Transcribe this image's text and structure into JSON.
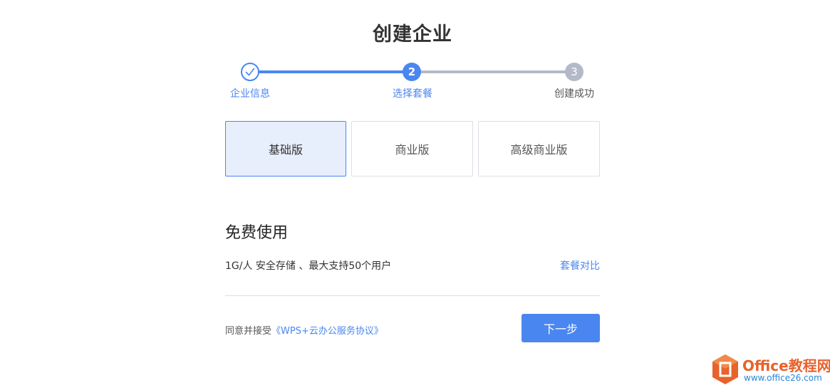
{
  "page": {
    "title": "创建企业"
  },
  "stepper": {
    "steps": [
      {
        "label": "企业信息",
        "number": "1",
        "state": "done"
      },
      {
        "label": "选择套餐",
        "number": "2",
        "state": "active"
      },
      {
        "label": "创建成功",
        "number": "3",
        "state": "todo"
      }
    ]
  },
  "plans": [
    {
      "label": "基础版",
      "selected": true
    },
    {
      "label": "商业版",
      "selected": false
    },
    {
      "label": "高级商业版",
      "selected": false
    }
  ],
  "plan_detail": {
    "name": "免费使用",
    "description": "1G/人 安全存储 、最大支持50个用户",
    "compare_link": "套餐对比"
  },
  "agreement": {
    "prefix": "同意并接受",
    "link": "《WPS+云办公服务协议》"
  },
  "next_button": "下一步",
  "watermark": {
    "text": "Office教程网",
    "url": "www.office26.com"
  },
  "colors": {
    "accent": "#4a86f0",
    "inactive": "#b3b9c7",
    "selected_bg": "#e7eefc",
    "watermark_orange": "#e8622c"
  }
}
